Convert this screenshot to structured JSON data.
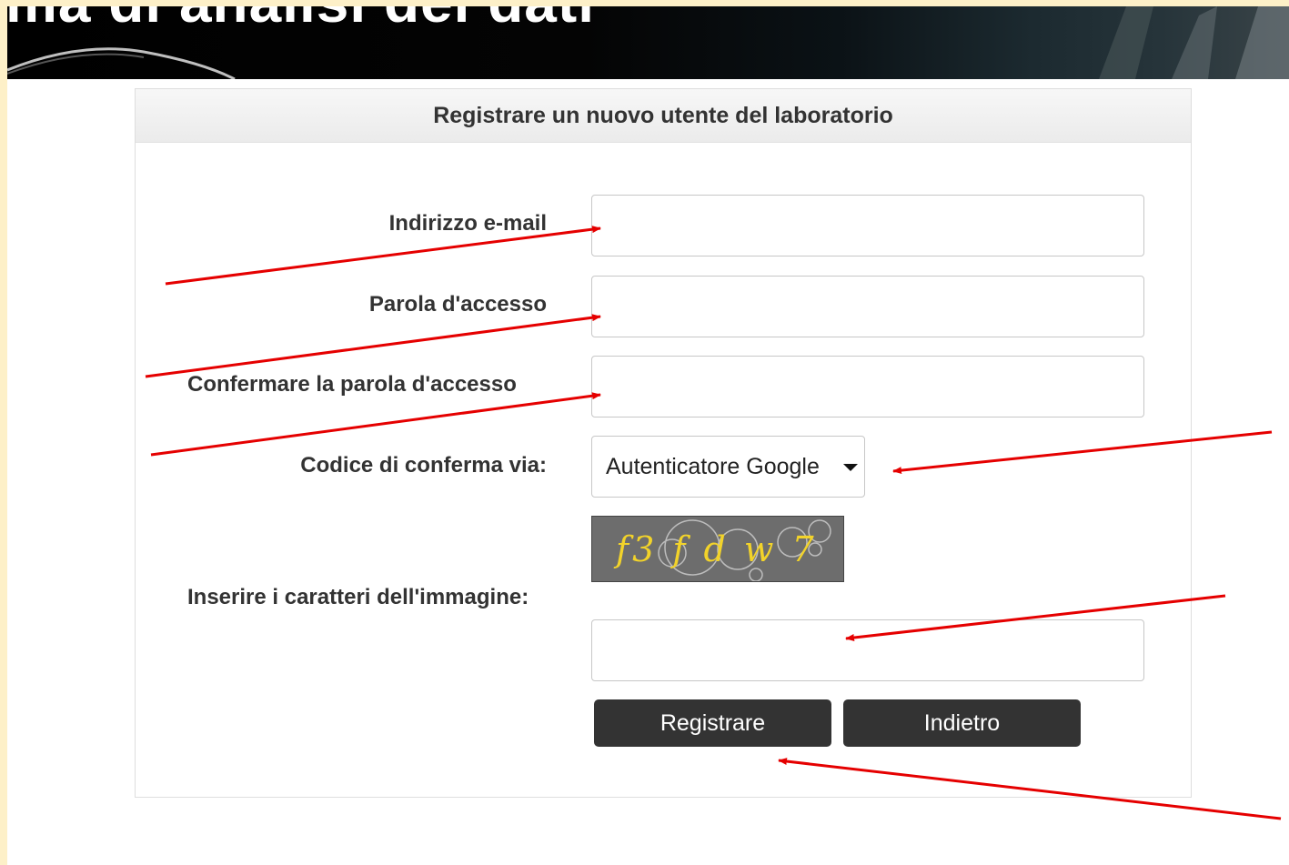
{
  "banner": {
    "title_fragment": "ma di analisi dei dati"
  },
  "form": {
    "title": "Registrare un nuovo utente del laboratorio",
    "email_label": "Indirizzo e-mail",
    "password_label": "Parola d'accesso",
    "confirm_label": "Confermare la parola d'accesso",
    "code_label": "Codice di conferma via:",
    "code_method": "Autenticatore Google",
    "captcha_label": "Inserire i caratteri dell'immagine:",
    "captcha_text": "f3 f d w 7",
    "register_button": "Registrare",
    "back_button": "Indietro"
  },
  "colors": {
    "annotation_arrow": "#e50000",
    "button_bg": "#333333",
    "captcha_text": "#f2d32a",
    "page_edge": "#fdf0c8"
  },
  "icons": {
    "dropdown": "caret-down-icon"
  }
}
